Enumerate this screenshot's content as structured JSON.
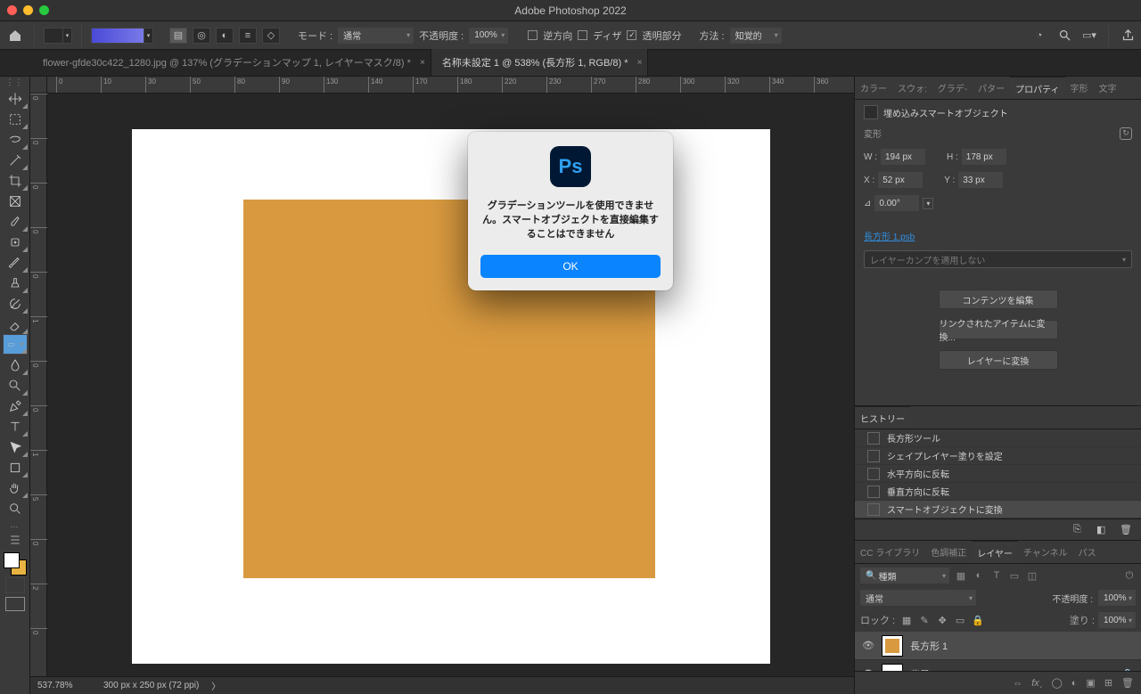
{
  "title": "Adobe Photoshop 2022",
  "optbar": {
    "mode_lbl": "モード :",
    "mode": "通常",
    "opacity_lbl": "不透明度 :",
    "opacity": "100%",
    "reverse": "逆方向",
    "dither": "ディザ",
    "trans": "透明部分",
    "method_lbl": "方法 :",
    "method": "知覚的"
  },
  "tabs": [
    {
      "label": "flower-gfde30c422_1280.jpg @ 137% (グラデーションマップ 1, レイヤーマスク/8) *"
    },
    {
      "label": "名称未設定 1 @ 538% (長方形 1, RGB/8) *"
    }
  ],
  "hrule": [
    "10",
    "30",
    "50",
    "80",
    "90",
    "130",
    "140",
    "170",
    "180",
    "220",
    "230",
    "270",
    "280",
    "300"
  ],
  "dialog": {
    "msg": "グラデーションツールを使用できません。スマートオブジェクトを直接編集することはできません",
    "ok": "OK"
  },
  "props": {
    "tabs": [
      "カラー",
      "スウォ:",
      "グラデ-",
      "パター",
      "プロパティ",
      "字形",
      "文字"
    ],
    "title": "埋め込みスマートオブジェクト",
    "transform": "変形",
    "W": "W :",
    "Wv": "194 px",
    "H": "H :",
    "Hv": "178 px",
    "X": "X :",
    "Xv": "52 px",
    "Y": "Y :",
    "Yv": "33 px",
    "ang": "0.00°",
    "file": "長方形 1.psb",
    "comp_ph": "レイヤーカンプを適用しない",
    "btn1": "コンテンツを編集",
    "btn2": "リンクされたアイテムに変換...",
    "btn3": "レイヤーに変換"
  },
  "hist": {
    "tab": "ヒストリー",
    "items": [
      "長方形ツール",
      "シェイプレイヤー塗りを設定",
      "水平方向に反転",
      "垂直方向に反転",
      "スマートオブジェクトに変換"
    ]
  },
  "layers": {
    "tabs": [
      "CC ライブラリ",
      "色調補正",
      "レイヤー",
      "チャンネル",
      "パス"
    ],
    "kind_ph": "種類",
    "blend": "通常",
    "opacity_lbl": "不透明度 :",
    "opacity": "100%",
    "lock": "ロック :",
    "fill_lbl": "塗り :",
    "fill": "100%",
    "items": [
      {
        "name": "長方形 1"
      },
      {
        "name": "背景"
      }
    ]
  },
  "status": {
    "zoom": "537.78%",
    "info": "300 px x 250 px (72 ppi)"
  }
}
